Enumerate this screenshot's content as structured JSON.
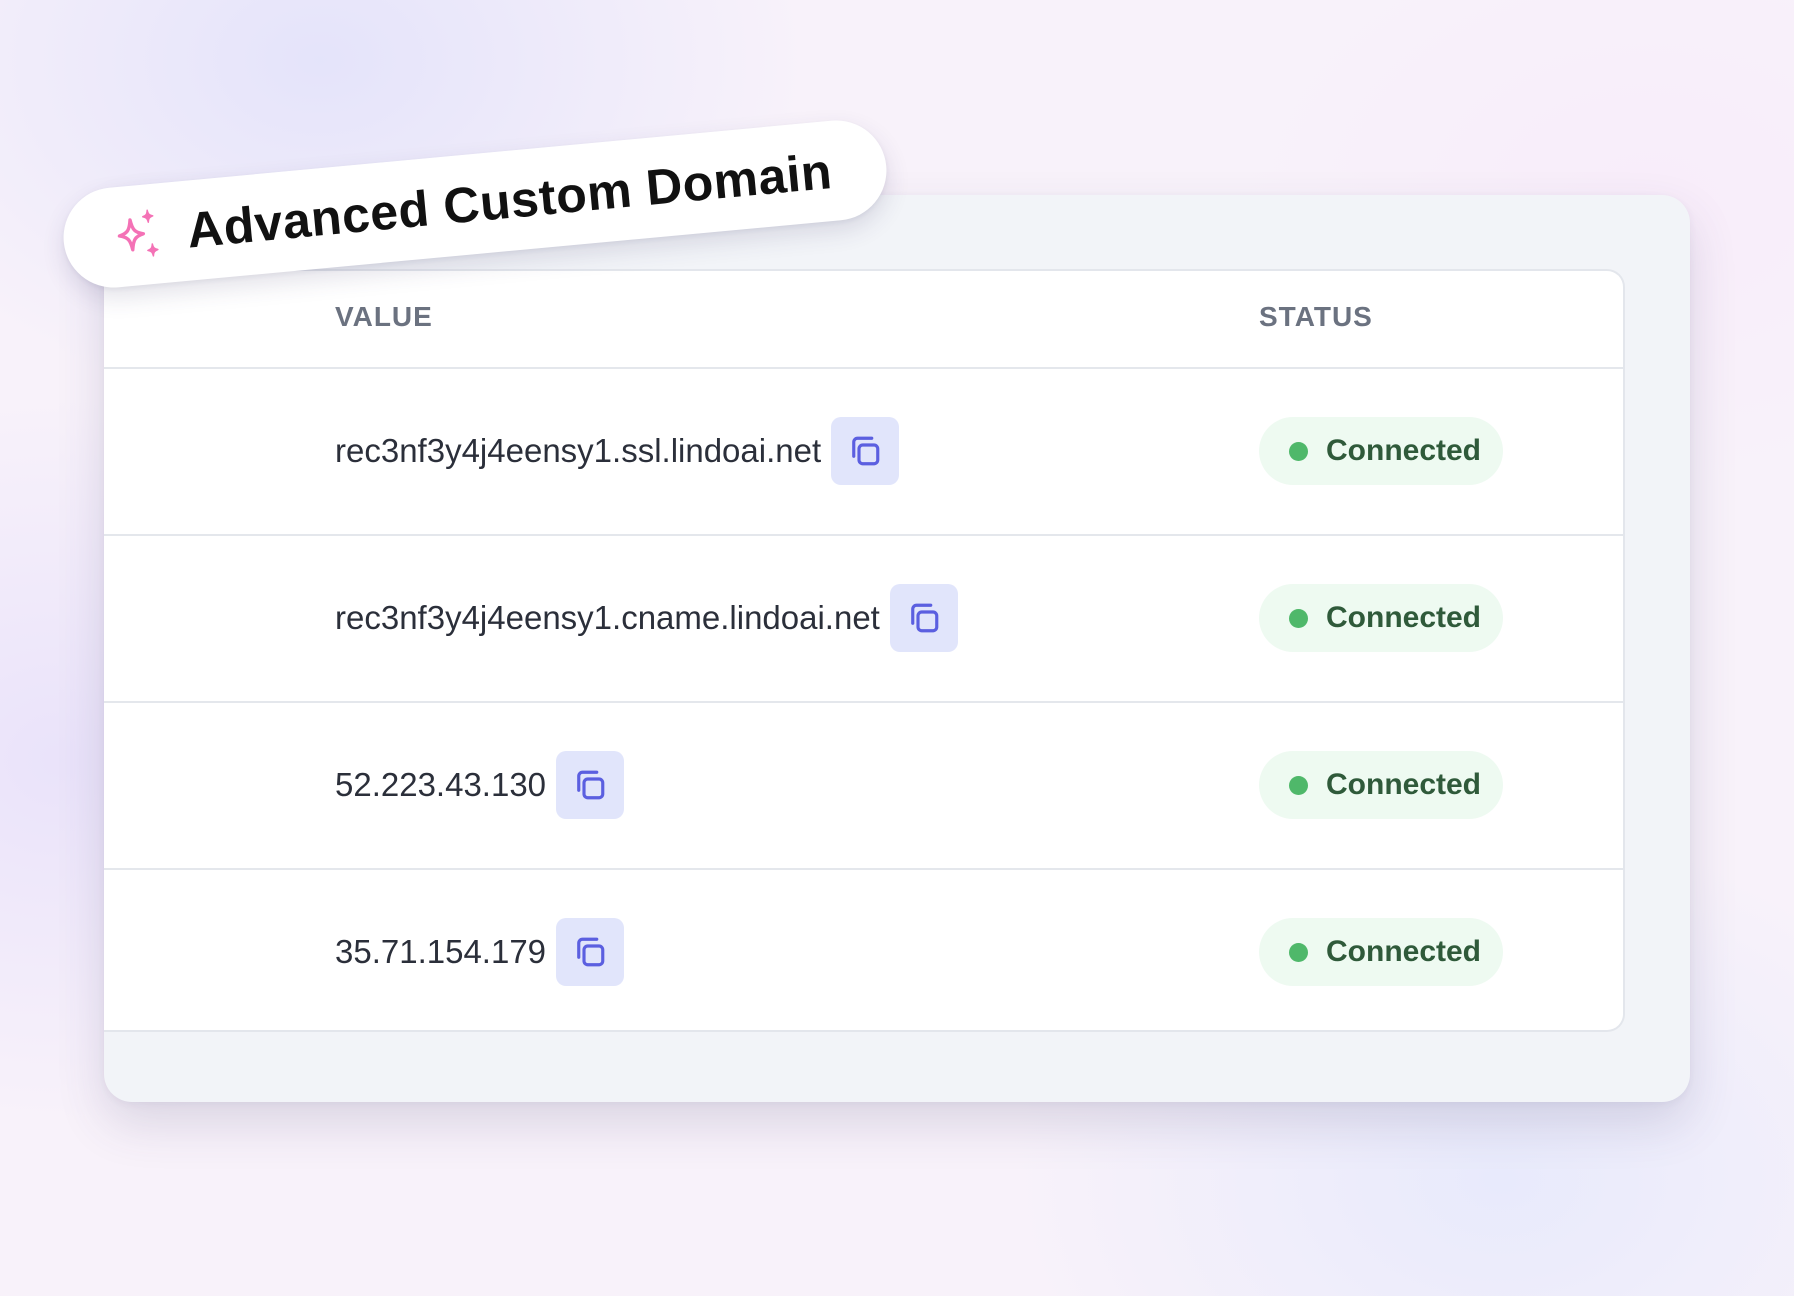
{
  "badge": {
    "title": "Advanced Custom Domain",
    "icon": "sparkles-icon",
    "icon_color": "#f472b6"
  },
  "table": {
    "headers": {
      "value": "VALUE",
      "status": "STATUS"
    },
    "rows": [
      {
        "value": "rec3nf3y4j4eensy1.ssl.lindoai.net",
        "status": "Connected"
      },
      {
        "value": "rec3nf3y4j4eensy1.cname.lindoai.net",
        "status": "Connected"
      },
      {
        "value": "52.223.43.130",
        "status": "Connected"
      },
      {
        "value": "35.71.154.179",
        "status": "Connected"
      }
    ]
  },
  "colors": {
    "copy_icon": "#5b5fe0",
    "copy_button_bg": "#e1e5fb",
    "status_dot": "#4fb86a",
    "status_bg": "#eefaf1"
  }
}
